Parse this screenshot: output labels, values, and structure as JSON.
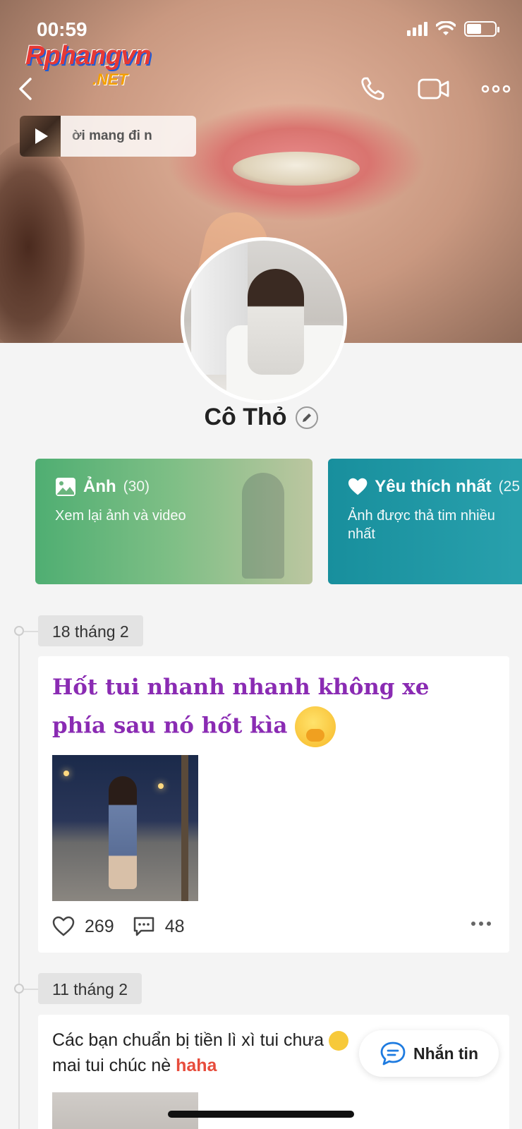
{
  "status_bar": {
    "time": "00:59"
  },
  "watermark": {
    "main": "Rphangvn",
    "sub": ".NET"
  },
  "nav": {
    "back_icon": "chevron-left-icon",
    "call_icon": "phone-icon",
    "video_icon": "video-camera-icon",
    "more_icon": "more-horizontal-icon"
  },
  "music": {
    "song_fragment": "ời mang đi          n"
  },
  "profile": {
    "name": "Cô Thỏ"
  },
  "cards": [
    {
      "title": "Ảnh",
      "count": "(30)",
      "desc": "Xem lại ảnh và video",
      "icon": "image-icon"
    },
    {
      "title": "Yêu thích nhất",
      "count": "(25",
      "desc": "Ảnh được thả tim nhiều nhất",
      "icon": "heart-icon"
    }
  ],
  "posts": [
    {
      "date": "18 tháng 2",
      "text": "Hốt tui nhanh nhanh không xe phía sau nó hốt kìa",
      "likes": "269",
      "comments": "48"
    },
    {
      "date": "11 tháng 2",
      "text_a": "Các bạn chuẩn bị tiền lì xì tui chưa",
      "text_b": "mai tui chúc nè",
      "highlight": "haha"
    }
  ],
  "message_button": {
    "label": "Nhắn tin"
  },
  "colors": {
    "accent_purple": "#8a2bb3",
    "card_green": "#4fae72",
    "card_teal": "#188f9d",
    "highlight_red": "#e74c3c"
  }
}
